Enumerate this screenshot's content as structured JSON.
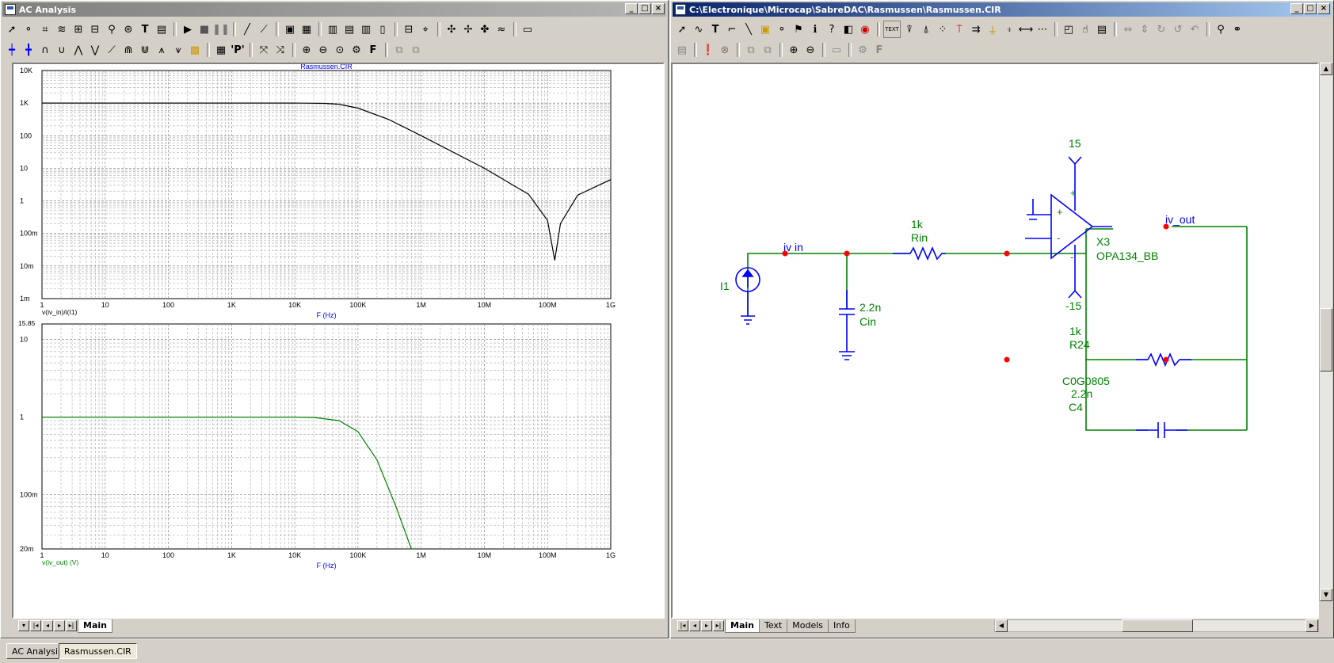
{
  "left_window": {
    "title": "AC Analysis",
    "controls": [
      "_",
      "□",
      "×"
    ],
    "tabs": [
      "Main"
    ]
  },
  "right_window": {
    "title": "C:\\Electronique\\Microcap\\SabreDAC\\Rasmussen\\Rasmussen.CIR",
    "controls": [
      "_",
      "□",
      "×"
    ],
    "tabs": [
      "Main",
      "Text",
      "Models",
      "Info"
    ]
  },
  "plot1": {
    "title": "Rasmussen.CIR",
    "y_tick_labels": [
      "10K",
      "1K",
      "100",
      "10",
      "1",
      "100m",
      "10m",
      "1m"
    ],
    "x_tick_labels": [
      "1",
      "10",
      "100",
      "1K",
      "10K",
      "100K",
      "1M",
      "10M",
      "100M",
      "1G"
    ],
    "xlabel": "F (Hz)",
    "expression": "v(iv_in)/i(I1)"
  },
  "plot2": {
    "y_top_label": "15.85",
    "y_tick_labels": [
      "10",
      "1",
      "100m",
      "20m"
    ],
    "x_tick_labels": [
      "1",
      "10",
      "100",
      "1K",
      "10K",
      "100K",
      "1M",
      "10M",
      "100M",
      "1G"
    ],
    "xlabel": "F (Hz)",
    "expression": "v(iv_out) (V)"
  },
  "chart_data": [
    {
      "type": "line",
      "title": "Rasmussen.CIR",
      "xlabel": "F (Hz)",
      "ylabel": "v(iv_in)/i(I1)",
      "x_scale": "log",
      "y_scale": "log",
      "xlim": [
        1,
        1000000000
      ],
      "ylim": [
        0.001,
        10000
      ],
      "grid": true,
      "color": "#000000",
      "series": [
        {
          "name": "v(iv_in)/i(I1)",
          "x": [
            1,
            10,
            100,
            1000,
            10000,
            30000,
            50000,
            100000,
            300000,
            1000000,
            10000000,
            50000000,
            100000000,
            130000000,
            160000000,
            300000000,
            1000000000
          ],
          "y": [
            1000,
            1000,
            1000,
            1000,
            1000,
            980,
            920,
            700,
            320,
            100,
            10,
            1.6,
            0.25,
            0.015,
            0.2,
            1.5,
            4.5
          ]
        }
      ]
    },
    {
      "type": "line",
      "xlabel": "F (Hz)",
      "ylabel": "v(iv_out) (V)",
      "x_scale": "log",
      "y_scale": "log",
      "xlim": [
        1,
        1000000000
      ],
      "ylim": [
        0.02,
        15.85
      ],
      "grid": true,
      "color": "#008000",
      "series": [
        {
          "name": "v(iv_out) (V)",
          "x": [
            1,
            10,
            100,
            1000,
            10000,
            20000,
            50000,
            100000,
            200000,
            400000,
            700000
          ],
          "y": [
            1,
            1,
            1,
            1,
            1,
            0.99,
            0.9,
            0.65,
            0.28,
            0.07,
            0.02
          ]
        }
      ]
    }
  ],
  "schematic": {
    "wire_color": "#008000",
    "component_color": "#0000ff",
    "label_color": "#008000",
    "node_label_color": "#0000ff",
    "components": {
      "i1": "I1",
      "cin_value": "2.2n",
      "cin_name": "Cin",
      "rin_value": "1k",
      "rin_name": "Rin",
      "r24_value": "1k",
      "r24_name": "R24",
      "c4_model": "C0G0805",
      "c4_value": "2.2n",
      "c4_name": "C4",
      "x3_name": "X3",
      "x3_model": "OPA134_BB",
      "vplus": "15",
      "vminus": "-15",
      "pin_plus": "+",
      "pin_minus": "-"
    },
    "node_labels": [
      "iv in",
      "iv_out"
    ]
  },
  "taskbar": [
    "AC Analysis",
    "Rasmussen.CIR"
  ]
}
